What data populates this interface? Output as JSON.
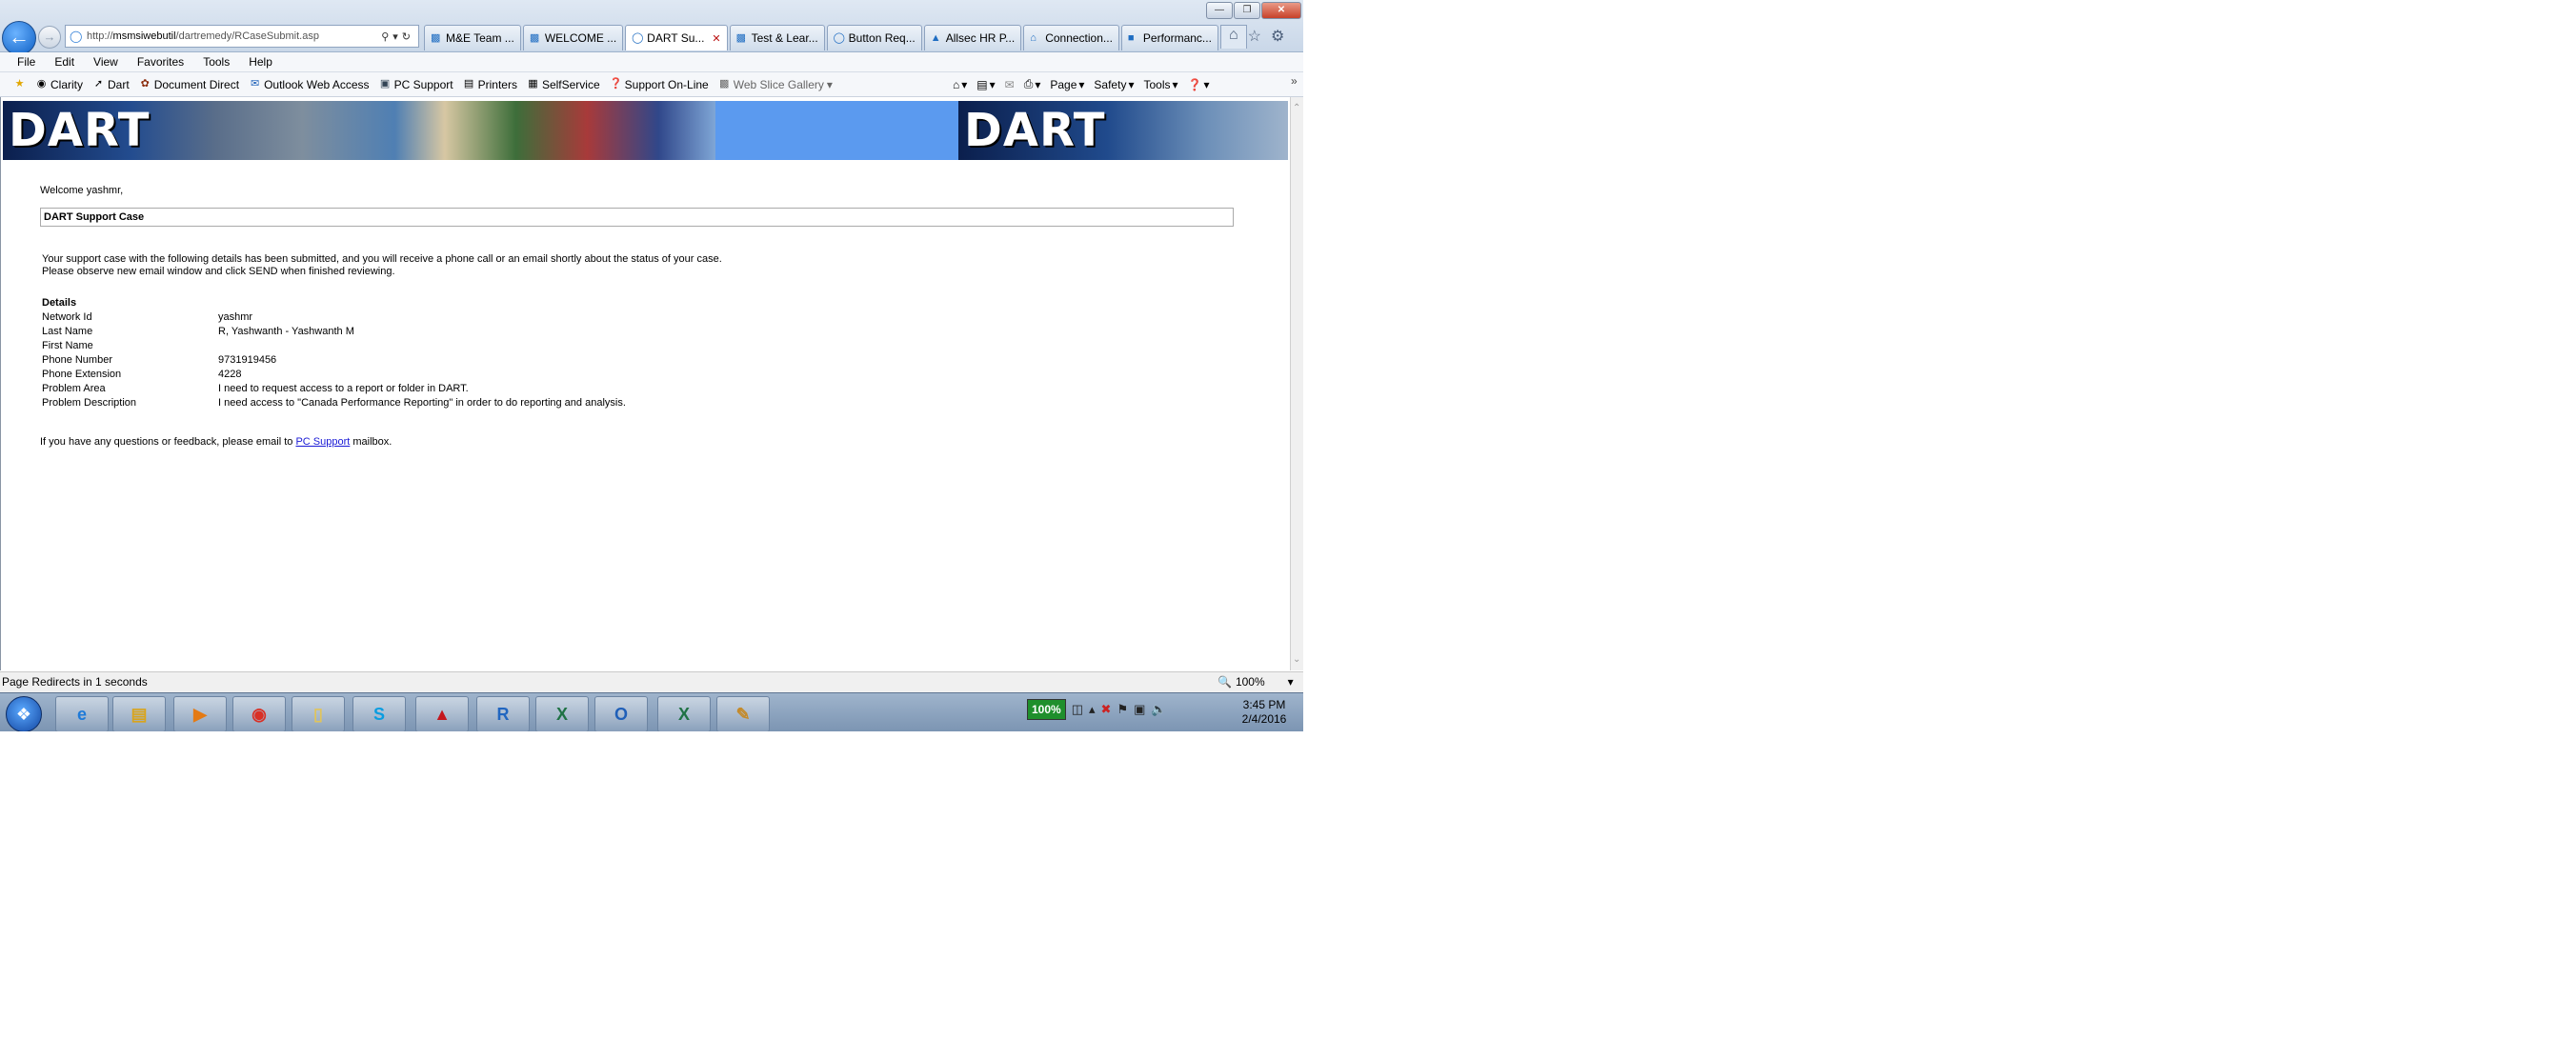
{
  "browser": {
    "url_prefix": "http://",
    "url_host": "msmsiwebutil",
    "url_path": "/dartremedy/RCaseSubmit.asp",
    "tabs": [
      {
        "label": "M&E Team ..."
      },
      {
        "label": "WELCOME ..."
      },
      {
        "label": "DART Su..."
      },
      {
        "label": "Test & Lear..."
      },
      {
        "label": "Button Req..."
      },
      {
        "label": "Allsec HR P..."
      },
      {
        "label": "Connection..."
      },
      {
        "label": "Performanc..."
      }
    ],
    "menu": [
      "File",
      "Edit",
      "View",
      "Favorites",
      "Tools",
      "Help"
    ],
    "favorites": [
      "Clarity",
      "Dart",
      "Document Direct",
      "Outlook Web Access",
      "PC Support",
      "Printers",
      "SelfService",
      "Support On-Line",
      "Web Slice Gallery"
    ],
    "commands": {
      "page": "Page",
      "safety": "Safety",
      "tools": "Tools"
    }
  },
  "page": {
    "banner_text_left": "DART",
    "banner_text_right": "DART",
    "welcome": "Welcome yashmr,",
    "case_title": "DART Support Case",
    "message_line1": "Your support case with the following details has been submitted, and you will receive a phone call or an email shortly about the status of your case.",
    "message_line2": "Please observe new email window and click SEND when finished reviewing.",
    "details_heading": "Details",
    "details": [
      {
        "k": "Network Id",
        "v": "yashmr"
      },
      {
        "k": "Last Name",
        "v": "R, Yashwanth - Yashwanth M"
      },
      {
        "k": "First Name",
        "v": ""
      },
      {
        "k": "Phone Number",
        "v": "9731919456"
      },
      {
        "k": "Phone Extension",
        "v": "4228"
      },
      {
        "k": "Problem Area",
        "v": "I need to request access to a report or folder in DART."
      },
      {
        "k": "Problem Description",
        "v": "I need access to \"Canada Performance Reporting\" in order to do reporting and analysis."
      }
    ],
    "footer_before": "If you have any questions or feedback, please email to ",
    "footer_link": "PC Support",
    "footer_after": " mailbox."
  },
  "status": {
    "text": "Page Redirects in 1 seconds",
    "zoom": "100%"
  },
  "taskbar": {
    "battery": "100%",
    "time": "3:45 PM",
    "date": "2/4/2016"
  }
}
